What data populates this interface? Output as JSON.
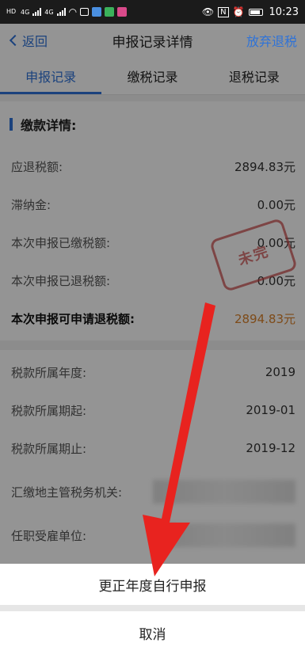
{
  "status_bar": {
    "signal_label_1": "4G",
    "signal_label_2": "4G",
    "hd_label_1": "HD",
    "hd_label_2": "HD",
    "nfc_label": "N",
    "time": "10:23"
  },
  "nav": {
    "back_label": "返回",
    "title": "申报记录详情",
    "action_label": "放弃退税"
  },
  "tabs": [
    {
      "label": "申报记录",
      "active": true
    },
    {
      "label": "缴税记录",
      "active": false
    },
    {
      "label": "退税记录",
      "active": false
    }
  ],
  "section": {
    "title": "缴款详情:"
  },
  "stamp_text": "未完",
  "payment_rows": [
    {
      "label": "应退税额:",
      "value": "2894.83元"
    },
    {
      "label": "滞纳金:",
      "value": "0.00元"
    },
    {
      "label": "本次申报已缴税额:",
      "value": "0.00元"
    },
    {
      "label": "本次申报已退税额:",
      "value": "0.00元"
    },
    {
      "label": "本次申报可申请退税额:",
      "value": "2894.83元"
    }
  ],
  "info_rows": [
    {
      "label": "税款所属年度:",
      "value": "2019"
    },
    {
      "label": "税款所属期起:",
      "value": "2019-01"
    },
    {
      "label": "税款所属期止:",
      "value": "2019-12"
    },
    {
      "label": "汇缴地主管税务机关:",
      "value": ""
    },
    {
      "label": "任职受雇单位:",
      "value": ""
    }
  ],
  "sheet": {
    "primary_label": "更正年度自行申报",
    "cancel_label": "取消"
  },
  "colors": {
    "accent": "#2f73d8",
    "refund_amount": "#d9822b",
    "stamp": "#c84040",
    "arrow": "#e8231f"
  }
}
